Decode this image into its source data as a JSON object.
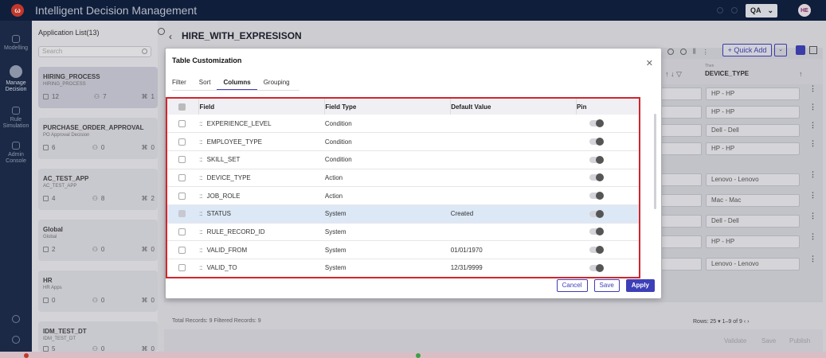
{
  "app": {
    "title": "Intelligent Decision Management",
    "logo_letter": "ω",
    "env": "QA",
    "avatar": "HE"
  },
  "nav": [
    {
      "label": "Modelling",
      "icon": "modelling-icon"
    },
    {
      "label": "Manage Decision",
      "icon": "manage-decision-icon"
    },
    {
      "label": "Rule Simulation",
      "icon": "rule-simulation-icon"
    },
    {
      "label": "Admin Console",
      "icon": "admin-console-icon"
    }
  ],
  "applist": {
    "title": "Application List(13)",
    "search_placeholder": "Search",
    "cards": [
      {
        "name": "HIRING_PROCESS",
        "sub": "HIRING_PROCESS",
        "a": "12",
        "b": "7",
        "c": "1"
      },
      {
        "name": "PURCHASE_ORDER_APPROVAL",
        "sub": "PO Approval Decision",
        "a": "6",
        "b": "0",
        "c": "0"
      },
      {
        "name": "AC_TEST_APP",
        "sub": "AC_TEST_APP",
        "a": "4",
        "b": "8",
        "c": "2"
      },
      {
        "name": "Global",
        "sub": "Global",
        "a": "2",
        "b": "0",
        "c": "0"
      },
      {
        "name": "HR",
        "sub": "HR Apps",
        "a": "0",
        "b": "0",
        "c": "0"
      },
      {
        "name": "IDM_TEST_DT",
        "sub": "IDM_TEST_DT",
        "a": "5",
        "b": "0",
        "c": "0"
      }
    ]
  },
  "main": {
    "page_title": "HIRE_WITH_EXPRESISON",
    "quick_add": "+ Quick Add",
    "column": {
      "then": "Then",
      "name": "DEVICE_TYPE"
    },
    "device_values": [
      "HP - HP",
      "HP - HP",
      "Dell - Dell",
      "HP - HP",
      "Lenovo - Lenovo",
      "Mac - Mac",
      "Dell - Dell",
      "HP - HP",
      "Lenovo - Lenovo"
    ],
    "records": "Total Records: 9 Filtered Records: 9",
    "rows": "Rows:  25 ▾     1–9 of 9     ‹     ›",
    "footer_buttons": [
      "Validate",
      "Save",
      "Publish"
    ]
  },
  "modal": {
    "title": "Table Customization",
    "tabs": [
      "Filter",
      "Sort",
      "Columns",
      "Grouping"
    ],
    "active_tab": "Columns",
    "headers": [
      "Field",
      "Field Type",
      "Default Value",
      "Pin"
    ],
    "rows": [
      {
        "field": "EXPERIENCE_LEVEL",
        "type": "Condition",
        "default": "",
        "checked": false
      },
      {
        "field": "EMPLOYEE_TYPE",
        "type": "Condition",
        "default": "",
        "checked": false
      },
      {
        "field": "SKILL_SET",
        "type": "Condition",
        "default": "",
        "checked": false
      },
      {
        "field": "DEVICE_TYPE",
        "type": "Action",
        "default": "",
        "checked": false
      },
      {
        "field": "JOB_ROLE",
        "type": "Action",
        "default": "",
        "checked": false
      },
      {
        "field": "STATUS",
        "type": "System",
        "default": "Created",
        "checked": true
      },
      {
        "field": "RULE_RECORD_ID",
        "type": "System",
        "default": "",
        "checked": false
      },
      {
        "field": "VALID_FROM",
        "type": "System",
        "default": "01/01/1970",
        "checked": false
      },
      {
        "field": "VALID_TO",
        "type": "System",
        "default": "12/31/9999",
        "checked": false
      }
    ],
    "buttons": {
      "cancel": "Cancel",
      "save": "Save",
      "apply": "Apply"
    }
  }
}
